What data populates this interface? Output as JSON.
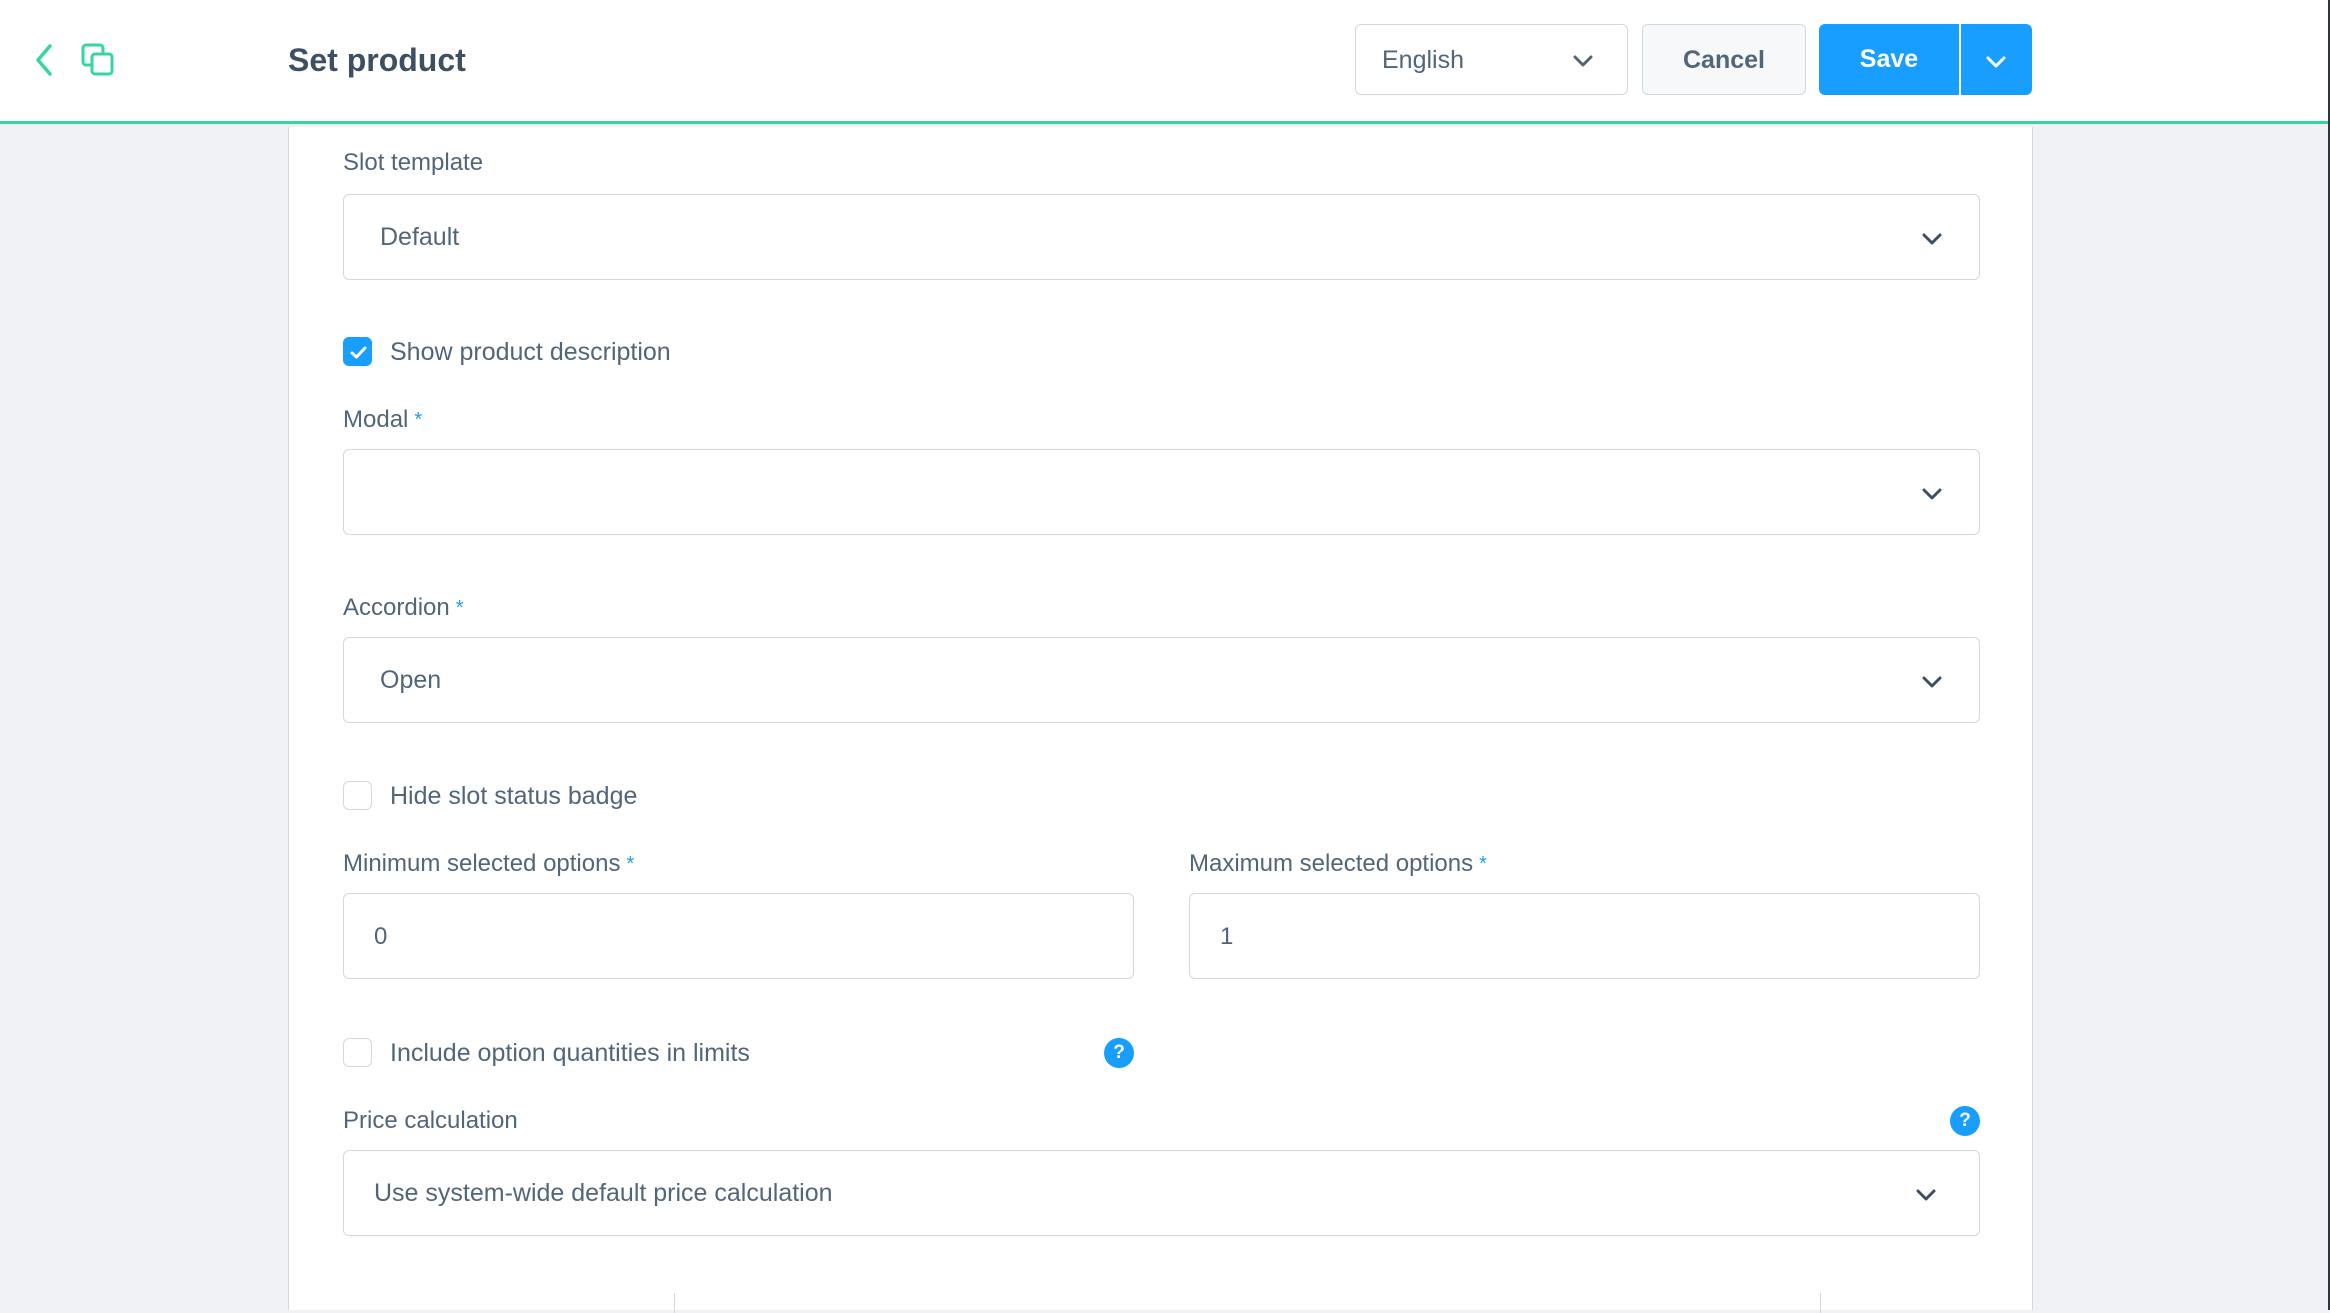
{
  "header": {
    "title": "Set product",
    "language": "English",
    "cancel_label": "Cancel",
    "save_label": "Save"
  },
  "form": {
    "slot_template": {
      "label": "Slot template",
      "value": "Default"
    },
    "show_description": {
      "label": "Show product description",
      "checked": true
    },
    "modal": {
      "label": "Modal",
      "required_mark": "*",
      "value": ""
    },
    "accordion": {
      "label": "Accordion",
      "required_mark": "*",
      "value": "Open"
    },
    "hide_status_badge": {
      "label": "Hide slot status badge",
      "checked": false
    },
    "min_options": {
      "label": "Minimum selected options",
      "required_mark": "*",
      "value": "0"
    },
    "max_options": {
      "label": "Maximum selected options",
      "required_mark": "*",
      "value": "1"
    },
    "include_quantities": {
      "label": "Include option quantities in limits",
      "checked": false
    },
    "price_calculation": {
      "label": "Price calculation",
      "value": "Use system-wide default price calculation"
    },
    "help_glyph": "?"
  },
  "colors": {
    "accent": "#189eff",
    "header_border": "#37d6a0",
    "icon_green": "#37d6a0",
    "text": "#52667a"
  }
}
